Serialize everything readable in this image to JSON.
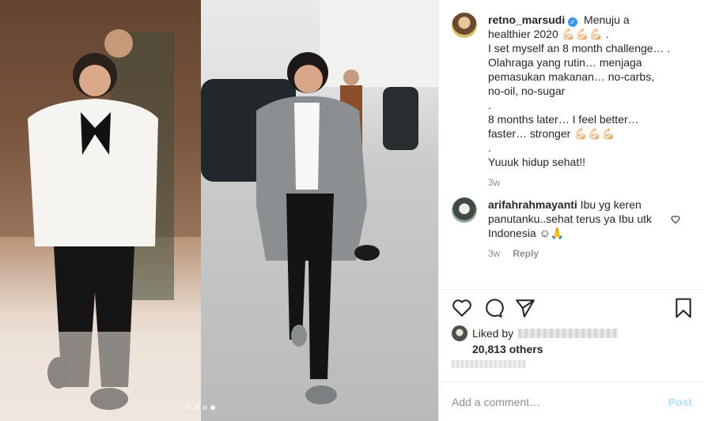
{
  "media": {
    "carousel_dots": 4,
    "active_dot": 4
  },
  "caption": {
    "username": "retno_marsudi",
    "lines": [
      "Menuju a healthier 2020 💪🏻💪🏻💪🏻 .",
      "I set myself an 8 month challenge… .",
      "Olahraga yang rutin… menjaga pemasukan makanan… no-carbs, no-oil, no-sugar",
      ".",
      "8 months later… I feel better… faster… stronger 💪🏻💪🏻💪🏻",
      ".",
      "Yuuuk hidup sehat!!"
    ],
    "time": "3w"
  },
  "comment": {
    "username": "arifahrahmayanti",
    "text": "Ibu yg keren panutanku..sehat terus ya Ibu utk Indonesia ☺🙏",
    "time": "3w",
    "reply_label": "Reply"
  },
  "likes": {
    "liked_by_label": "Liked by",
    "others": "20,813 others"
  },
  "add_comment": {
    "placeholder": "Add a comment…",
    "post_label": "Post"
  },
  "colors": {
    "verified": "#3897f0",
    "post_disabled": "#b2dffc",
    "muted": "#8e8e8e"
  }
}
